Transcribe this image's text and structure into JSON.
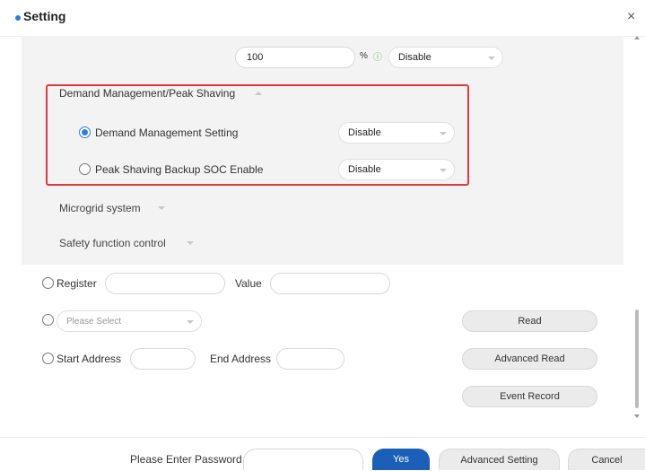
{
  "window": {
    "title": "Setting",
    "close_glyph": "×"
  },
  "panel": {
    "top_row": {
      "input_value": "100",
      "unit": "%",
      "info_glyph": "ⓘ",
      "select_value": "Disable"
    },
    "demand_section": {
      "header": "Demand Management/Peak Shaving",
      "options": [
        {
          "label": "Demand Management Setting",
          "selected": true,
          "select_value": "Disable"
        },
        {
          "label": "Peak Shaving Backup SOC Enable",
          "selected": false,
          "select_value": "Disable"
        }
      ]
    },
    "microgrid_label": "Microgrid system",
    "safety_label": "Safety function control"
  },
  "register_row": {
    "register_label": "Register",
    "value_label": "Value"
  },
  "select_row": {
    "placeholder": "Please Select"
  },
  "address_row": {
    "start_label": "Start Address",
    "end_label": "End Address"
  },
  "actions": {
    "read": "Read",
    "advanced_read": "Advanced Read",
    "event_record": "Event Record"
  },
  "footer": {
    "password_label": "Please Enter Password",
    "yes": "Yes",
    "advanced_setting": "Advanced Setting",
    "cancel": "Cancel"
  },
  "colors": {
    "accent": "#2a7fd9",
    "primary_button": "#1c5fb8",
    "highlight": "#e0393e",
    "panel_bg": "#f3f3f3"
  }
}
